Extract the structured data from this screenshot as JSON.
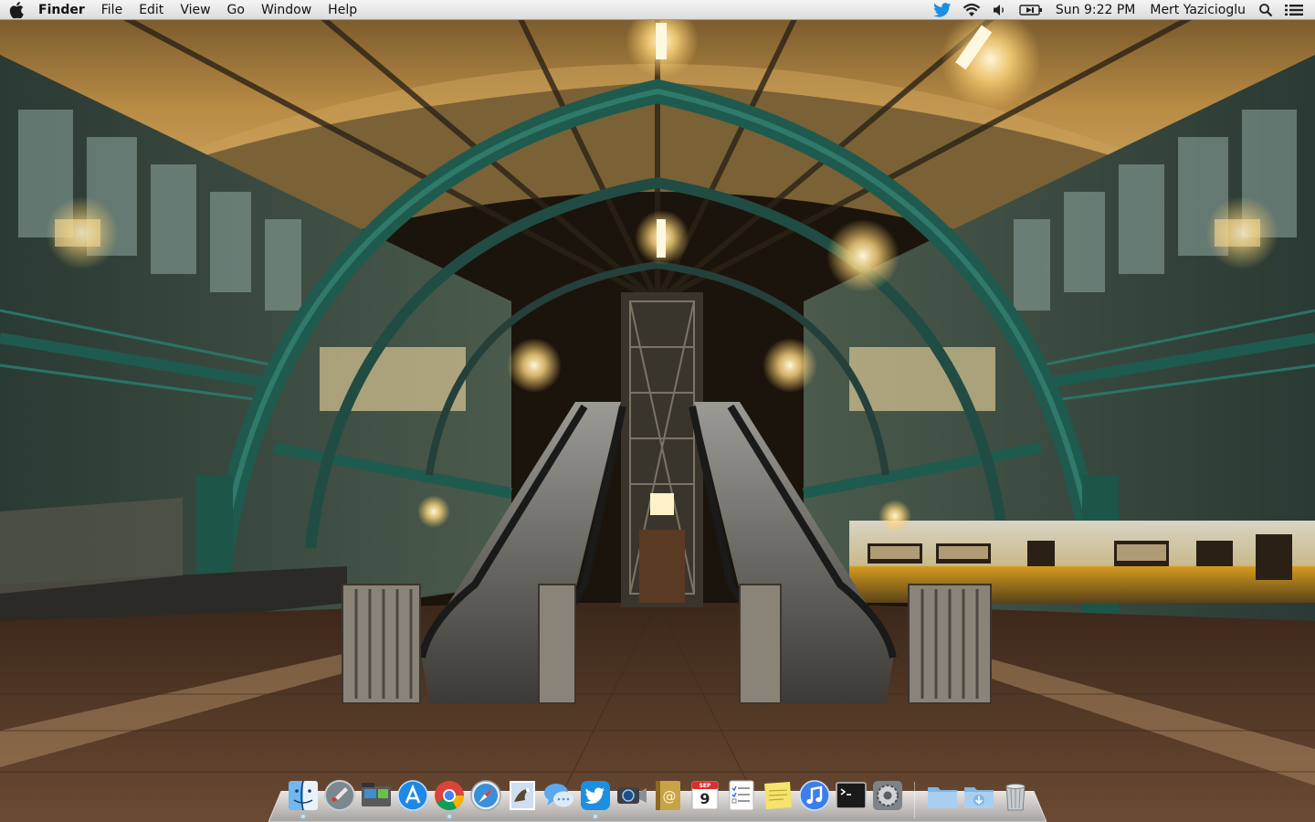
{
  "menubar": {
    "app_name": "Finder",
    "menus": [
      "File",
      "Edit",
      "View",
      "Go",
      "Window",
      "Help"
    ],
    "status": {
      "clock": "Sun 9:22 PM",
      "user": "Mert Yazicioglu"
    },
    "icons": [
      "apple-icon",
      "twitter-icon",
      "wifi-icon",
      "volume-icon",
      "battery-icon",
      "spotlight-icon",
      "notification-center-icon"
    ]
  },
  "dock": {
    "apps": [
      {
        "name": "finder",
        "running": true
      },
      {
        "name": "launchpad",
        "running": false
      },
      {
        "name": "image-capture",
        "running": false
      },
      {
        "name": "app-store",
        "running": false
      },
      {
        "name": "chrome",
        "running": true
      },
      {
        "name": "safari",
        "running": false
      },
      {
        "name": "mail-eagle",
        "running": false
      },
      {
        "name": "messages",
        "running": false
      },
      {
        "name": "twitter",
        "running": true
      },
      {
        "name": "facetime",
        "running": false
      },
      {
        "name": "contacts",
        "running": false
      },
      {
        "name": "calendar",
        "running": false
      },
      {
        "name": "reminders",
        "running": false
      },
      {
        "name": "stickies",
        "running": false
      },
      {
        "name": "itunes",
        "running": false
      },
      {
        "name": "terminal",
        "running": false
      },
      {
        "name": "system-preferences",
        "running": false
      },
      {
        "name": "applications-folder",
        "running": false
      },
      {
        "name": "downloads-folder",
        "running": false
      },
      {
        "name": "trash",
        "running": false
      }
    ],
    "calendar_day": "9",
    "calendar_month": "SEP"
  },
  "colors": {
    "steel_green": "#1f5a4e",
    "ceiling_gold": "#b9893f",
    "floor_brown": "#5a3a22",
    "twitter_blue": "#1d8fe0"
  }
}
